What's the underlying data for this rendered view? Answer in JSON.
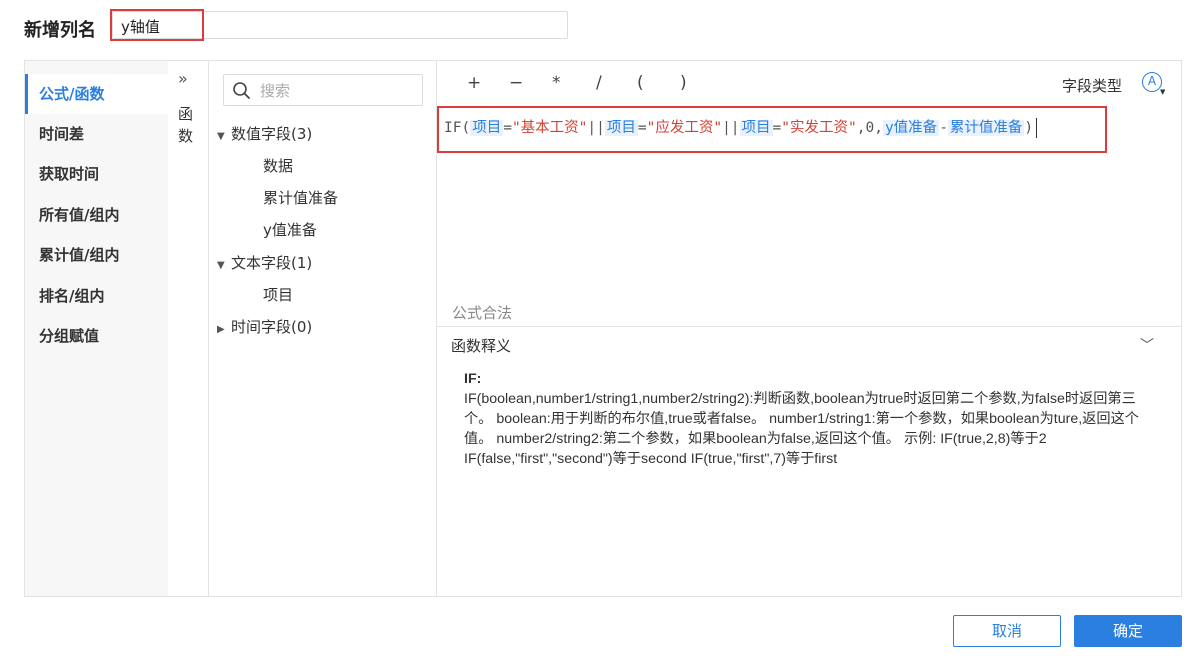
{
  "header": {
    "label": "新增列名",
    "column_name_value": "y轴值"
  },
  "categories": [
    {
      "label": "公式/函数",
      "active": true
    },
    {
      "label": "时间差"
    },
    {
      "label": "获取时间"
    },
    {
      "label": "所有值/组内"
    },
    {
      "label": "累计值/组内"
    },
    {
      "label": "排名/组内"
    },
    {
      "label": "分组赋值"
    }
  ],
  "function_toggle": {
    "arrow": "»",
    "label": "函数"
  },
  "fields": {
    "search_placeholder": "搜索",
    "groups": [
      {
        "label": "数值字段(3)",
        "expanded": true,
        "items": [
          "数据",
          "累计值准备",
          "y值准备"
        ]
      },
      {
        "label": "文本字段(1)",
        "expanded": true,
        "items": [
          "项目"
        ]
      },
      {
        "label": "时间字段(0)",
        "expanded": false,
        "items": []
      }
    ]
  },
  "toolbar": {
    "operators": [
      "+",
      "−",
      "*",
      "/",
      "(",
      ")"
    ],
    "field_type_label": "字段类型",
    "field_type_icon": "A"
  },
  "formula": {
    "tokens": [
      {
        "t": "IF(",
        "k": "plain"
      },
      {
        "t": "项目",
        "k": "field"
      },
      {
        "t": "=",
        "k": "plain"
      },
      {
        "t": "\"基本工资\"",
        "k": "str"
      },
      {
        "t": "||",
        "k": "plain"
      },
      {
        "t": "项目",
        "k": "field"
      },
      {
        "t": "=",
        "k": "plain"
      },
      {
        "t": "\"应发工资\"",
        "k": "str"
      },
      {
        "t": "||",
        "k": "plain"
      },
      {
        "t": "项目",
        "k": "field"
      },
      {
        "t": "=",
        "k": "plain"
      },
      {
        "t": "\"实发工资\"",
        "k": "str"
      },
      {
        "t": ",0,",
        "k": "plain"
      },
      {
        "t": "y值准备",
        "k": "field"
      },
      {
        "t": "-",
        "k": "plain"
      },
      {
        "t": "累计值准备",
        "k": "field"
      },
      {
        "t": ")",
        "k": "plain"
      }
    ]
  },
  "validation_text": "公式合法",
  "description": {
    "title": "函数释义",
    "function_name": "IF:",
    "text": "IF(boolean,number1/string1,number2/string2):判断函数,boolean为true时返回第二个参数,为false时返回第三个。 boolean:用于判断的布尔值,true或者false。 number1/string1:第一个参数，如果boolean为ture,返回这个值。 number2/string2:第二个参数，如果boolean为false,返回这个值。 示例: IF(true,2,8)等于2 IF(false,\"first\",\"second\")等于second IF(true,\"first\",7)等于first"
  },
  "buttons": {
    "cancel": "取消",
    "ok": "确定"
  },
  "colors": {
    "accent": "#2a7fe0",
    "highlight_box": "#e0393e",
    "string_literal": "#d04437"
  }
}
